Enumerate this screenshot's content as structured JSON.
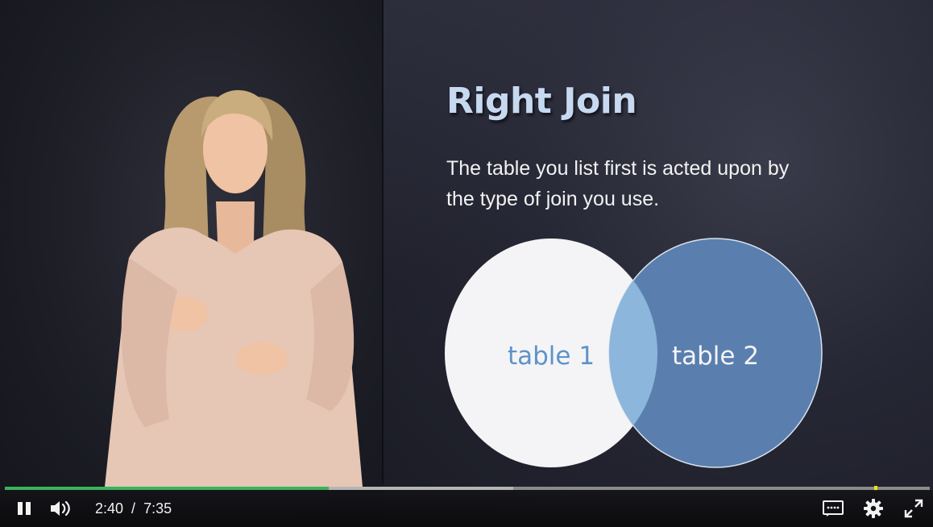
{
  "slide": {
    "title": "Right Join",
    "body": "The table you list first is acted upon by the type of join you use.",
    "venn": {
      "left_label": "table 1",
      "right_label": "table 2"
    }
  },
  "player": {
    "current_time": "2:40",
    "separator": "/",
    "duration": "7:35",
    "progress_fraction": 0.35,
    "buffered_fraction": 0.55,
    "marker_fraction": 0.94,
    "state": "playing",
    "icons": {
      "play_pause": "pause-icon",
      "volume": "volume-icon",
      "captions": "captions-icon",
      "settings": "gear-icon",
      "fullscreen": "fullscreen-icon"
    },
    "colors": {
      "progress": "#3bb35c",
      "marker": "#f2e400"
    }
  }
}
